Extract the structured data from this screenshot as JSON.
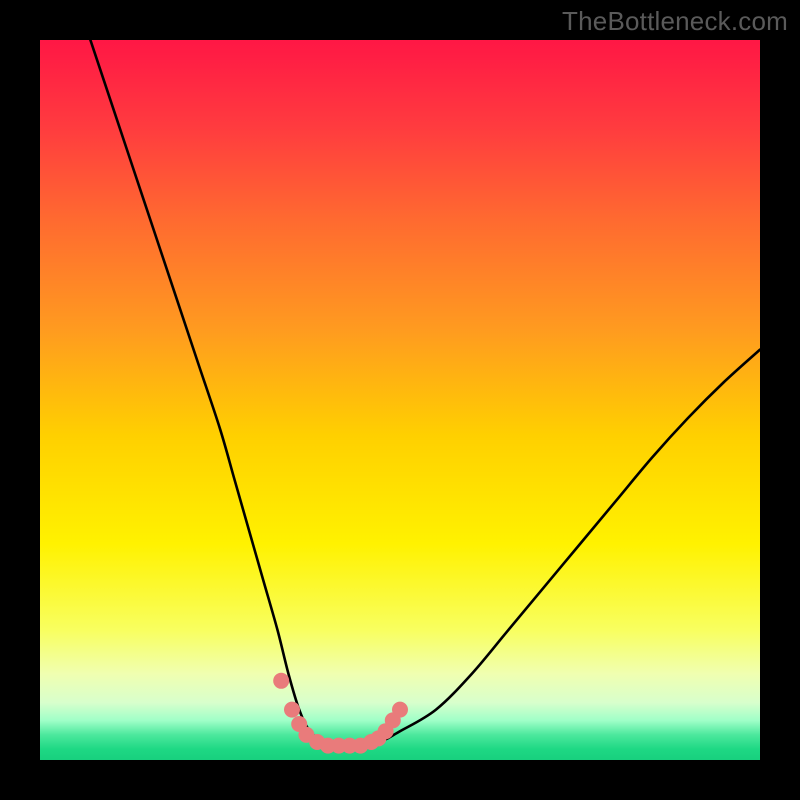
{
  "watermark": "TheBottleneck.com",
  "gradient": {
    "stops": [
      {
        "offset": 0.0,
        "color": "#ff1745"
      },
      {
        "offset": 0.12,
        "color": "#ff3b3f"
      },
      {
        "offset": 0.25,
        "color": "#ff6a30"
      },
      {
        "offset": 0.4,
        "color": "#ff9a20"
      },
      {
        "offset": 0.55,
        "color": "#ffd000"
      },
      {
        "offset": 0.7,
        "color": "#fff200"
      },
      {
        "offset": 0.82,
        "color": "#f8ff60"
      },
      {
        "offset": 0.88,
        "color": "#f0ffb0"
      },
      {
        "offset": 0.92,
        "color": "#d8ffcc"
      },
      {
        "offset": 0.945,
        "color": "#a0ffc8"
      },
      {
        "offset": 0.965,
        "color": "#4ce89d"
      },
      {
        "offset": 0.985,
        "color": "#1ed884"
      },
      {
        "offset": 1.0,
        "color": "#18d07e"
      }
    ]
  },
  "chart_data": {
    "type": "line",
    "title": "",
    "xlabel": "",
    "ylabel": "",
    "xlim": [
      0,
      100
    ],
    "ylim": [
      0,
      100
    ],
    "series": [
      {
        "name": "curve",
        "x": [
          7,
          10,
          13,
          16,
          19,
          22,
          25,
          27,
          29,
          31,
          33,
          34.5,
          36,
          37.5,
          40,
          43,
          47,
          50,
          55,
          60,
          65,
          70,
          75,
          80,
          85,
          90,
          95,
          100
        ],
        "y": [
          100,
          91,
          82,
          73,
          64,
          55,
          46,
          39,
          32,
          25,
          18,
          12,
          7,
          4,
          2,
          2,
          2.5,
          4,
          7,
          12,
          18,
          24,
          30,
          36,
          42,
          47.5,
          52.5,
          57
        ]
      }
    ],
    "highlight": {
      "name": "pink-trough-dots",
      "color": "#e97b7b",
      "radius_px": 8,
      "x": [
        33.5,
        35,
        36,
        37,
        38.5,
        40,
        41.5,
        43,
        44.5,
        46,
        47,
        48,
        49,
        50
      ],
      "y": [
        11,
        7,
        5,
        3.5,
        2.5,
        2,
        2,
        2,
        2,
        2.5,
        3,
        4,
        5.5,
        7
      ]
    }
  }
}
